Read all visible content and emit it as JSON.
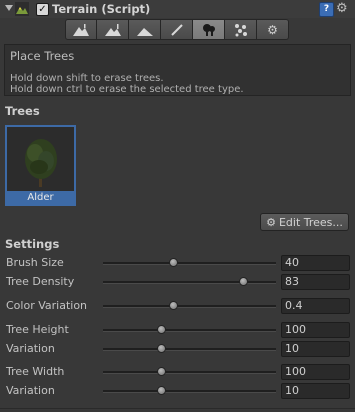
{
  "component": {
    "title": "Terrain (Script)",
    "enabled": true,
    "enabled_glyph": "✓",
    "help_glyph": "?",
    "menu_glyph": "⚙"
  },
  "toolbar": {
    "tools": [
      {
        "name": "raise-lower-terrain-icon",
        "glyph": "▲"
      },
      {
        "name": "paint-height-icon",
        "glyph": "▲"
      },
      {
        "name": "smooth-height-icon",
        "glyph": "▲"
      },
      {
        "name": "paint-texture-icon",
        "glyph": "✎"
      },
      {
        "name": "place-trees-icon",
        "glyph": "♣",
        "active": true
      },
      {
        "name": "paint-details-icon",
        "glyph": "✿"
      },
      {
        "name": "terrain-settings-icon",
        "glyph": "⚙"
      }
    ]
  },
  "help": {
    "title": "Place Trees",
    "line1": "Hold down shift to erase trees.",
    "line2": "Hold down ctrl to erase the selected tree type."
  },
  "trees": {
    "section_label": "Trees",
    "items": [
      {
        "label": "Alder",
        "selected": true
      }
    ],
    "edit_button": "Edit Trees...",
    "edit_glyph": "⚙"
  },
  "settings": {
    "section_label": "Settings",
    "brush_size": {
      "label": "Brush Size",
      "value": "40",
      "fraction": 0.4
    },
    "tree_density": {
      "label": "Tree Density",
      "value": "83",
      "fraction": 0.83
    },
    "color_variation": {
      "label": "Color Variation",
      "value": "0.4",
      "fraction": 0.4
    },
    "tree_height": {
      "label": "Tree Height",
      "value": "100",
      "fraction": 0.33
    },
    "height_variation": {
      "label": "Variation",
      "value": "10",
      "fraction": 0.33
    },
    "tree_width": {
      "label": "Tree Width",
      "value": "100",
      "fraction": 0.33
    },
    "width_variation": {
      "label": "Variation",
      "value": "10",
      "fraction": 0.33
    }
  },
  "colors": {
    "accent": "#3d6aa6",
    "panel": "#383838"
  }
}
